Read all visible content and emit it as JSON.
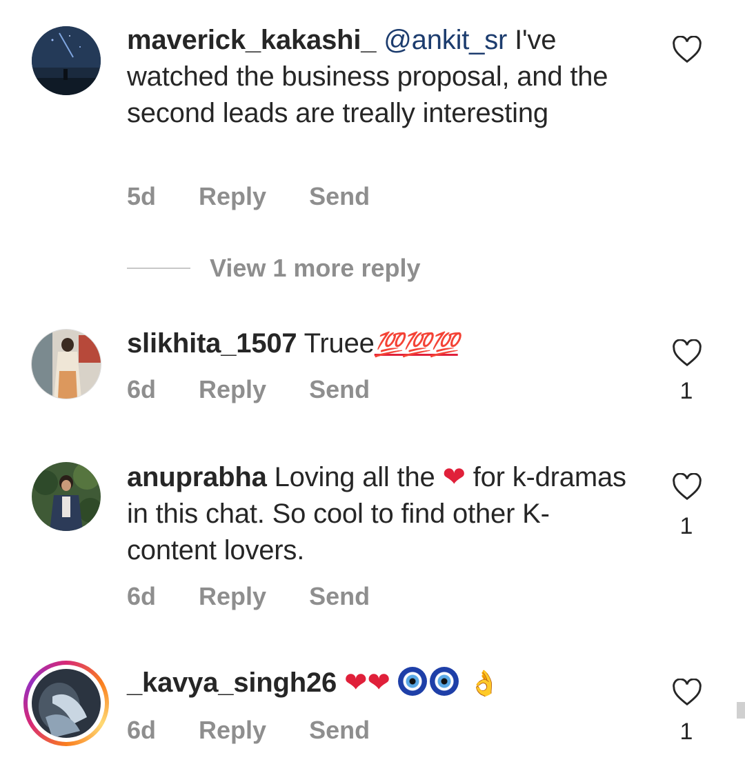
{
  "comments": [
    {
      "username": "maverick_kakashi_",
      "mention": "@ankit_sr",
      "text": "I've watched the business proposal, and the second leads are treally interesting",
      "age": "5d",
      "reply_label": "Reply",
      "send_label": "Send",
      "likes": ""
    },
    {
      "username": "slikhita_1507",
      "text": "Truee",
      "emojis": "💯💯💯",
      "age": "6d",
      "reply_label": "Reply",
      "send_label": "Send",
      "likes": "1"
    },
    {
      "username": "anuprabha",
      "text_before": "Loving all the",
      "heart": "❤",
      "text_after": "for k-dramas in this chat. So cool to find other K-content lovers.",
      "age": "6d",
      "reply_label": "Reply",
      "send_label": "Send",
      "likes": "1"
    },
    {
      "username": "_kavya_singh26",
      "hearts": "❤❤",
      "pinch": "👌",
      "age": "6d",
      "reply_label": "Reply",
      "send_label": "Send",
      "likes": "1"
    }
  ],
  "view_more_replies": "View 1 more reply",
  "colors": {
    "text": "#262626",
    "secondary": "#8e8e8e",
    "mention": "#1c3c6e",
    "emoji_red": "#e0203a"
  },
  "icons": {
    "like": "heart-outline-icon"
  }
}
